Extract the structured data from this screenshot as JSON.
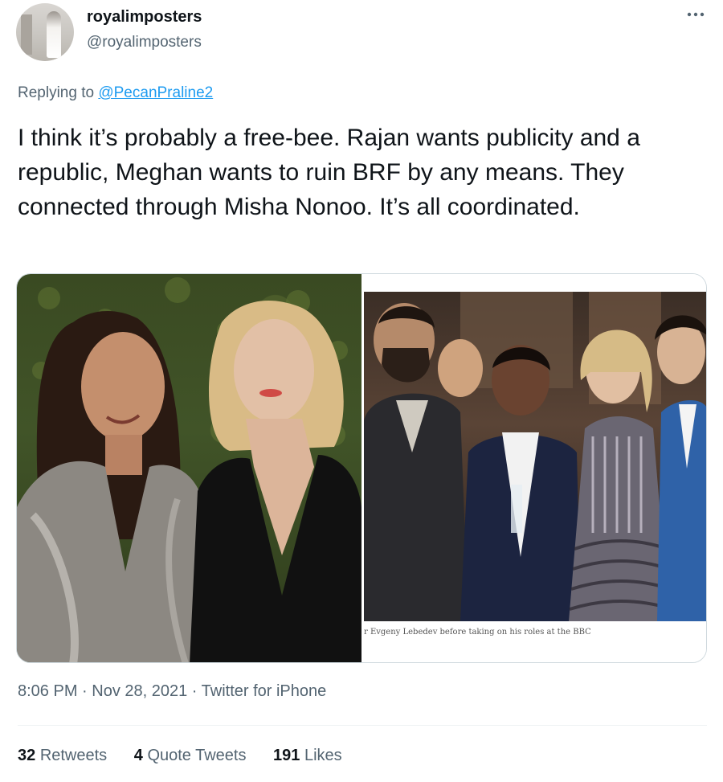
{
  "author": {
    "display_name": "royalimposters",
    "handle": "@royalimposters"
  },
  "reply": {
    "prefix": "Replying to",
    "mention": "@PecanPraline2"
  },
  "tweet": {
    "text": "I think it’s probably a free-bee. Rajan wants publicity and a republic, Meghan wants to ruin BRF by any means. They connected through Misha Nonoo. It’s all coordinated."
  },
  "media": {
    "right_caption": "r Evgeny Lebedev before taking on his roles at the BBC"
  },
  "meta": {
    "timestamp": "8:06 PM · Nov 28, 2021 · Twitter for iPhone"
  },
  "stats": {
    "retweets_count": "32",
    "retweets_label": "Retweets",
    "quotes_count": "4",
    "quotes_label": "Quote Tweets",
    "likes_count": "191",
    "likes_label": "Likes"
  },
  "icons": {
    "more": "more-icon"
  },
  "colors": {
    "accent": "#1d9bf0",
    "secondary_text": "#536471",
    "primary_text": "#0f1419"
  }
}
